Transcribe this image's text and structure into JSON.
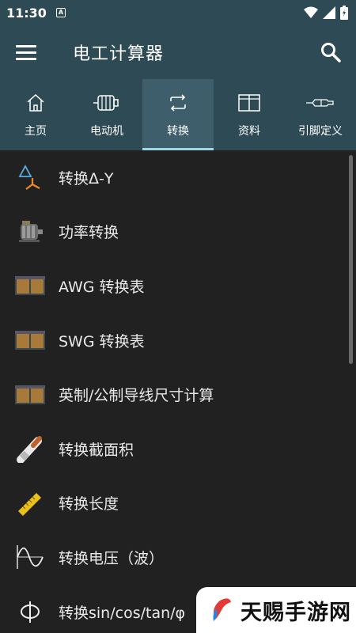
{
  "status": {
    "time": "11:30",
    "notification": "A"
  },
  "app": {
    "title": "电工计算器"
  },
  "tabs": [
    {
      "label": "主页",
      "icon": "home-icon",
      "active": false
    },
    {
      "label": "电动机",
      "icon": "motor-icon",
      "active": false
    },
    {
      "label": "转换",
      "icon": "convert-icon",
      "active": true
    },
    {
      "label": "资料",
      "icon": "book-icon",
      "active": false
    },
    {
      "label": "引脚定义",
      "icon": "connector-icon",
      "active": false
    }
  ],
  "items": [
    {
      "label": "转换Δ-Y",
      "icon": "delta-y-icon"
    },
    {
      "label": "功率转换",
      "icon": "motor-icon"
    },
    {
      "label": "AWG 转换表",
      "icon": "wire-table-icon"
    },
    {
      "label": "SWG 转换表",
      "icon": "wire-table-icon"
    },
    {
      "label": "英制/公制导线尺寸计算",
      "icon": "wire-table-icon"
    },
    {
      "label": "转换截面积",
      "icon": "cable-icon"
    },
    {
      "label": "转换长度",
      "icon": "ruler-icon"
    },
    {
      "label": "转换电压（波）",
      "icon": "sine-wave-icon"
    },
    {
      "label": "转换sin/cos/tan/φ",
      "icon": "phi-icon"
    }
  ],
  "watermark": {
    "text": "天赐手游网"
  },
  "colors": {
    "appbar": "#2e4a55",
    "active_tab": "#3d5e6a",
    "indicator": "#9fd6e6",
    "list_bg": "#212121"
  }
}
